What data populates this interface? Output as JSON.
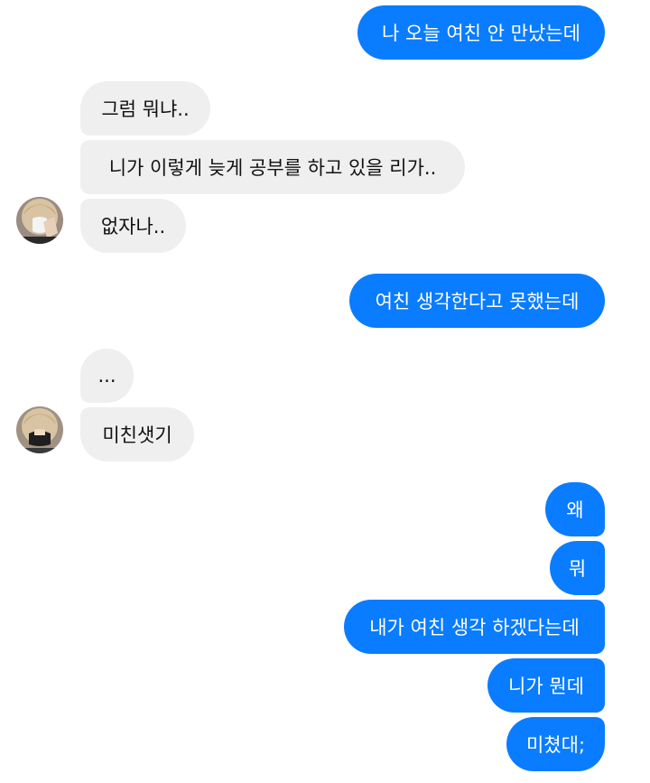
{
  "contact": {
    "avatar_icon": "profile-photo"
  },
  "messages": [
    {
      "dir": "out",
      "text": "나 오늘 여친 안 만났는데"
    },
    {
      "dir": "in",
      "text": "그럼 뭐냐.."
    },
    {
      "dir": "in",
      "text": "니가 이렇게 늦게 공부를 하고 있을 리가.."
    },
    {
      "dir": "in",
      "text": "없자나.."
    },
    {
      "dir": "out",
      "text": "여친 생각한다고 못했는데"
    },
    {
      "dir": "in",
      "text": "..."
    },
    {
      "dir": "in",
      "text": "미친샛기"
    },
    {
      "dir": "out",
      "text": "왜"
    },
    {
      "dir": "out",
      "text": "뭐"
    },
    {
      "dir": "out",
      "text": "내가 여친 생각 하겠다는데"
    },
    {
      "dir": "out",
      "text": "니가 뭔데"
    },
    {
      "dir": "out",
      "text": "미쳤대;"
    }
  ],
  "colors": {
    "outgoing": "#0a7cff",
    "incoming": "#efefef"
  }
}
